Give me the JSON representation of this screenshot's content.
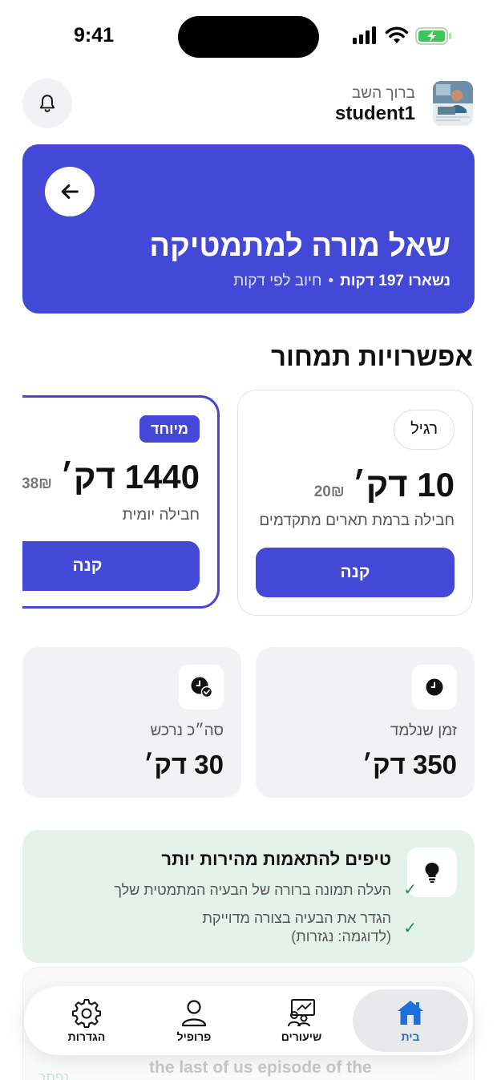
{
  "status_bar": {
    "time": "9:41"
  },
  "header": {
    "greeting": "ברוך השב",
    "username": "student1"
  },
  "hero": {
    "title": "שאל מורה למתמטיקה",
    "remaining": "נשארו 197 דקות",
    "billing": "חיוב לפי דקות"
  },
  "pricing": {
    "section_title": "אפשרויות תמחור",
    "packages": [
      {
        "badge": "רגיל",
        "amount": "10 דק׳",
        "price": "20₪",
        "description": "חבילה ברמת תארים מתקדמים",
        "buy_label": "קנה"
      },
      {
        "badge": "מיוחד",
        "amount": "1440 דק׳",
        "price": "38₪",
        "description": "חבילה יומית",
        "buy_label": "קנה"
      }
    ]
  },
  "stats": {
    "learned": {
      "label": "זמן שנלמד",
      "value": "350 דק׳"
    },
    "total": {
      "label": "סה״כ נרכש",
      "value": "30 דק׳"
    }
  },
  "tips": {
    "title": "טיפים להתאמות מהירות יותר",
    "items": [
      "העלה תמונה ברורה של הבעיה המתמטית שלך",
      "הגדר את הבעיה בצורה מדוייקת (לדוגמה: נגזרות)"
    ]
  },
  "background_card": {
    "text": "the last of us episode of the",
    "green_label": "נפתר"
  },
  "tabbar": {
    "home": "בית",
    "lessons": "שיעורים",
    "profile": "פרופיל",
    "settings": "הגדרות"
  },
  "colors": {
    "primary": "#4349d6",
    "tips_bg": "#e3f3ec",
    "check": "#1f8a4d",
    "home_active": "#1d6fdc"
  },
  "icons": [
    "signal-icon",
    "wifi-icon",
    "battery-charging-icon",
    "bell-icon",
    "arrow-left-icon",
    "clock-icon",
    "clock-check-icon",
    "lightbulb-icon",
    "check-icon",
    "home-icon",
    "lessons-icon",
    "user-icon",
    "gear-icon"
  ]
}
